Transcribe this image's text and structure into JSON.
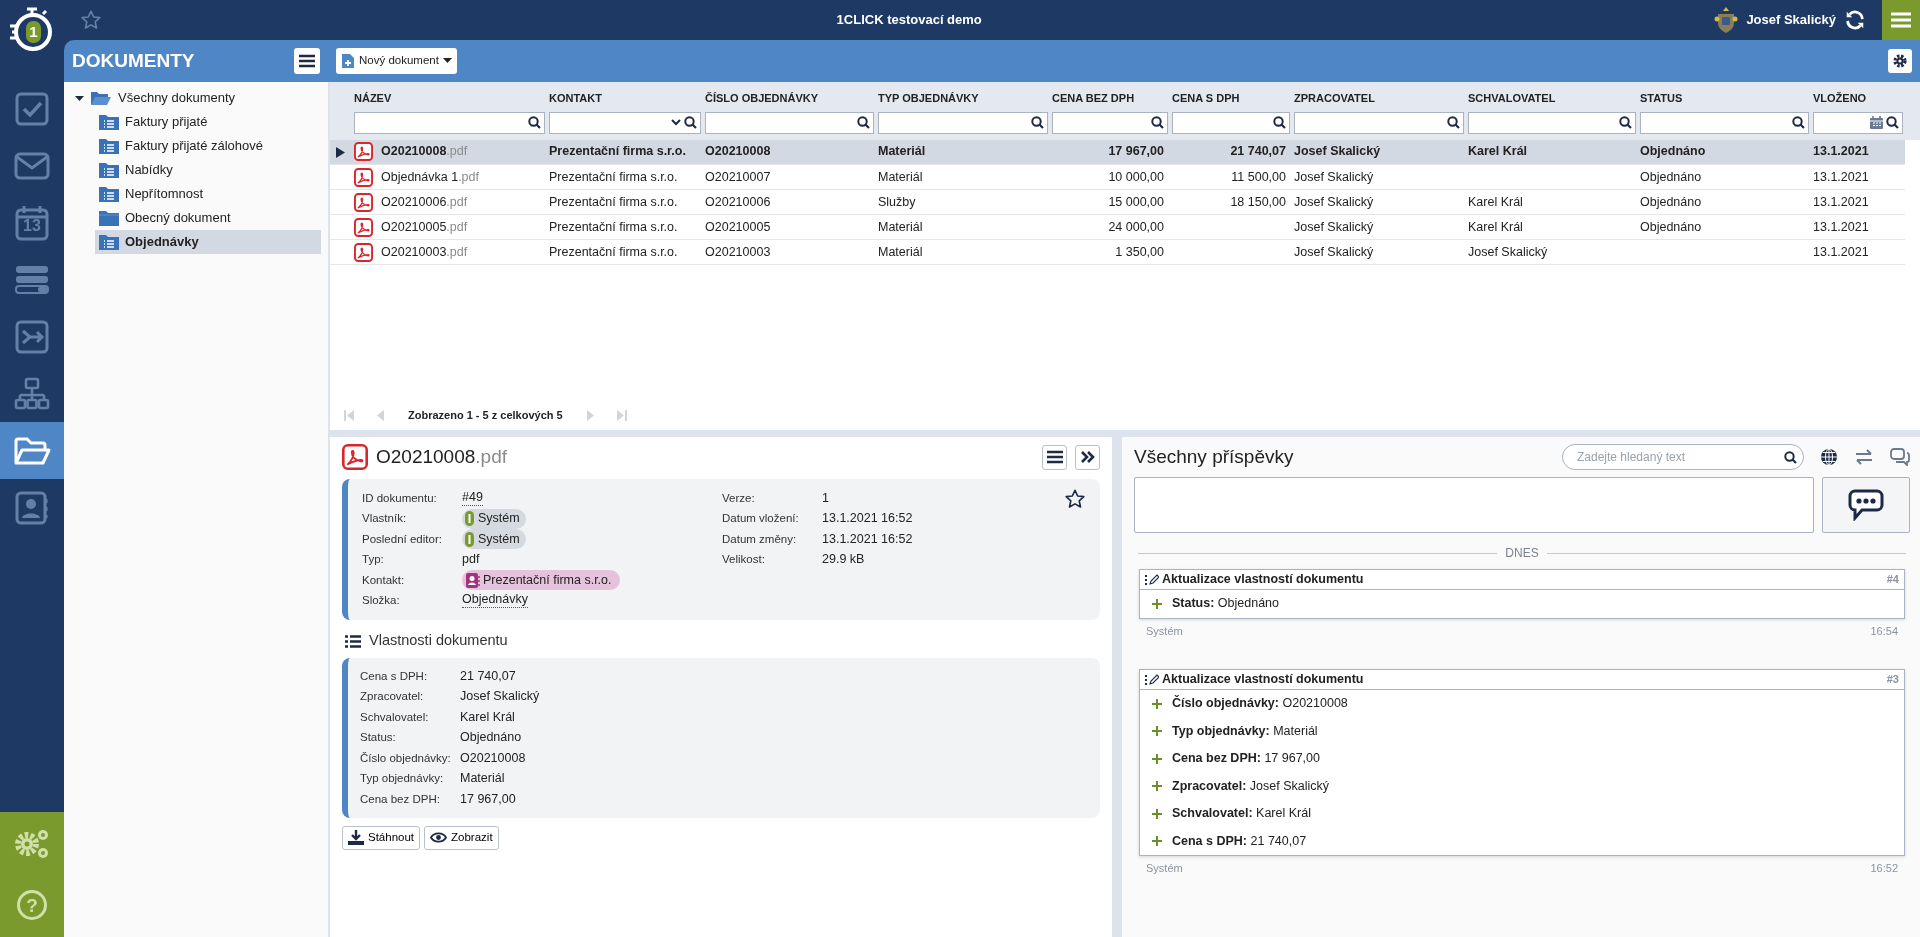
{
  "app": {
    "logo_mark": "1",
    "title": "1CLICK testovací demo",
    "user": "Josef Skalický"
  },
  "rail": [
    {
      "kind": "tasks",
      "selected": false
    },
    {
      "kind": "mail",
      "selected": false
    },
    {
      "kind": "calendar",
      "selected": false,
      "text": "13"
    },
    {
      "kind": "boards",
      "selected": false
    },
    {
      "kind": "workflow",
      "selected": false
    },
    {
      "kind": "org",
      "selected": false
    },
    {
      "kind": "documents",
      "selected": true
    },
    {
      "kind": "contacts",
      "selected": false
    }
  ],
  "rail_bottom": [
    {
      "kind": "settings"
    },
    {
      "kind": "help",
      "text": "?"
    }
  ],
  "panel": {
    "title": "DOKUMENTY",
    "new_button": "Nový dokument"
  },
  "tree": {
    "label": "Všechny dokumenty",
    "expanded": true,
    "selected": false,
    "children": [
      {
        "label": "Faktury přijaté",
        "kind": "list",
        "selected": false
      },
      {
        "label": "Faktury přijaté zálohové",
        "kind": "list",
        "selected": false
      },
      {
        "label": "Nabídky",
        "kind": "list",
        "selected": false
      },
      {
        "label": "Nepřítomnost",
        "kind": "list",
        "selected": false
      },
      {
        "label": "Obecný dokument",
        "kind": "plain",
        "selected": false
      },
      {
        "label": "Objednávky",
        "kind": "list",
        "selected": true
      }
    ]
  },
  "table": {
    "columns": [
      {
        "label": "NÁZEV",
        "kind": "text",
        "numeric": false
      },
      {
        "label": "KONTAKT",
        "kind": "select",
        "numeric": false
      },
      {
        "label": "ČÍSLO OBJEDNÁVKY",
        "kind": "text",
        "numeric": false
      },
      {
        "label": "TYP OBJEDNÁVKY",
        "kind": "text",
        "numeric": false
      },
      {
        "label": "CENA BEZ DPH",
        "kind": "text",
        "numeric": true
      },
      {
        "label": "CENA S DPH",
        "kind": "text",
        "numeric": true
      },
      {
        "label": "ZPRACOVATEL",
        "kind": "text",
        "numeric": false
      },
      {
        "label": "SCHVALOVATEL",
        "kind": "text",
        "numeric": false
      },
      {
        "label": "STATUS",
        "kind": "text",
        "numeric": false
      },
      {
        "label": "VLOŽENO",
        "kind": "date",
        "numeric": false
      }
    ],
    "rows": [
      {
        "selected": true,
        "cells": [
          {
            "name": "O20210008",
            "extension": ".pdf"
          },
          "Prezentační firma s.r.o.",
          "O20210008",
          "Materiál",
          "17 967,00",
          "21 740,07",
          "Josef Skalický",
          "Karel Král",
          "Objednáno",
          "13.1.2021"
        ]
      },
      {
        "selected": false,
        "cells": [
          {
            "name": "Objednávka 1",
            "extension": ".pdf"
          },
          "Prezentační firma s.r.o.",
          "O20210007",
          "Materiál",
          "10 000,00",
          "11 500,00",
          "Josef Skalický",
          null,
          "Objednáno",
          "13.1.2021"
        ]
      },
      {
        "selected": false,
        "cells": [
          {
            "name": "O20210006",
            "extension": ".pdf"
          },
          "Prezentační firma s.r.o.",
          "O20210006",
          "Služby",
          "15 000,00",
          "18 150,00",
          "Josef Skalický",
          "Karel Král",
          "Objednáno",
          "13.1.2021"
        ]
      },
      {
        "selected": false,
        "cells": [
          {
            "name": "O20210005",
            "extension": ".pdf"
          },
          "Prezentační firma s.r.o.",
          "O20210005",
          "Materiál",
          "24 000,00",
          null,
          "Josef Skalický",
          "Karel Král",
          "Objednáno",
          "13.1.2021"
        ]
      },
      {
        "selected": false,
        "cells": [
          {
            "name": "O20210003",
            "extension": ".pdf"
          },
          "Prezentační firma s.r.o.",
          "O20210003",
          "Materiál",
          "1 350,00",
          null,
          "Josef Skalický",
          "Josef Skalický",
          null,
          "13.1.2021"
        ]
      }
    ],
    "pagination": "Zobrazeno 1 - 5 z celkových 5"
  },
  "detail": {
    "name": "O20210008",
    "extension": ".pdf",
    "starred": false,
    "info_left": [
      {
        "label": "ID dokumentu:",
        "value": "#49",
        "kind": "link"
      },
      {
        "label": "Vlastník:",
        "value": "Systém",
        "kind": "system"
      },
      {
        "label": "Poslední editor:",
        "value": "Systém",
        "kind": "system"
      },
      {
        "label": "Typ:",
        "value": "pdf",
        "kind": "text"
      },
      {
        "label": "Kontakt:",
        "value": "Prezentační firma s.r.o.",
        "kind": "contact"
      },
      {
        "label": "Složka:",
        "value": "Objednávky",
        "kind": "link"
      }
    ],
    "info_right": [
      {
        "label": "Verze:",
        "value": "1",
        "kind": "text"
      },
      {
        "label": "Datum vložení:",
        "value": "13.1.2021 16:52",
        "kind": "text"
      },
      {
        "label": "Datum změny:",
        "value": "13.1.2021 16:52",
        "kind": "text"
      },
      {
        "label": "Velikost:",
        "value": "29.9 kB",
        "kind": "text"
      }
    ],
    "properties_title": "Vlastnosti dokumentu",
    "properties": [
      {
        "label": "Cena s DPH:",
        "value": "21 740,07"
      },
      {
        "label": "Zpracovatel:",
        "value": "Josef Skalický"
      },
      {
        "label": "Schvalovatel:",
        "value": "Karel Král"
      },
      {
        "label": "Status:",
        "value": "Objednáno"
      },
      {
        "label": "Číslo objednávky:",
        "value": "O20210008"
      },
      {
        "label": "Typ objednávky:",
        "value": "Materiál"
      },
      {
        "label": "Cena bez DPH:",
        "value": "17 967,00"
      }
    ],
    "buttons": [
      {
        "label": "Stáhnout",
        "kind": "download"
      },
      {
        "label": "Zobrazit",
        "kind": "view"
      }
    ]
  },
  "feed": {
    "title": "Všechny příspěvky",
    "search": {
      "placeholder": "Zadejte hledaný text"
    },
    "day": "DNES",
    "posts": [
      {
        "title": "Aktualizace vlastností dokumentu",
        "number": "#4",
        "changes": [
          {
            "label": "Status:",
            "value": "Objednáno"
          }
        ],
        "author": "Systém",
        "time": "16:54"
      },
      {
        "title": "Aktualizace vlastností dokumentu",
        "number": "#3",
        "changes": [
          {
            "label": "Číslo objednávky:",
            "value": "O20210008"
          },
          {
            "label": "Typ objednávky:",
            "value": "Materiál"
          },
          {
            "label": "Cena bez DPH:",
            "value": "17 967,00"
          },
          {
            "label": "Zpracovatel:",
            "value": "Josef Skalický"
          },
          {
            "label": "Schvalovatel:",
            "value": "Karel Král"
          },
          {
            "label": "Cena s DPH:",
            "value": "21 740,07"
          }
        ],
        "author": "Systém",
        "time": "16:52"
      }
    ]
  }
}
